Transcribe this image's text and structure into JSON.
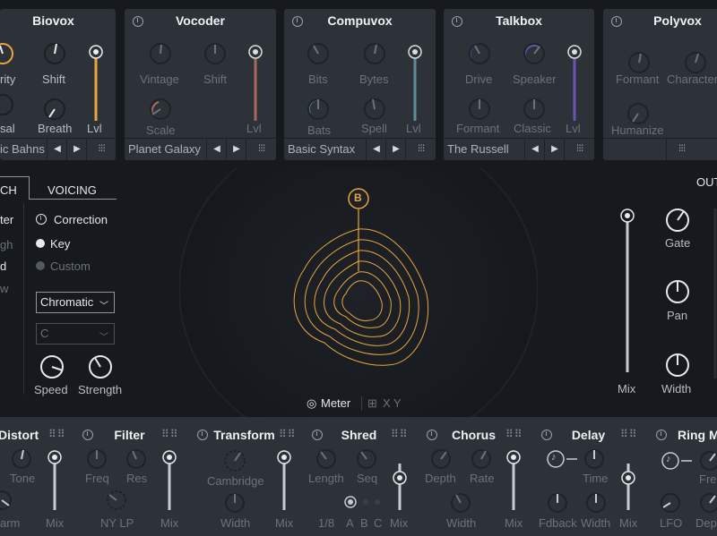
{
  "modules": [
    {
      "id": "biovox",
      "title": "Biovox",
      "knobs": [
        "rity",
        "Shift",
        "sal",
        "Breath"
      ],
      "lvl": "Lvl",
      "preset": "ic Bahns"
    },
    {
      "id": "vocoder",
      "title": "Vocoder",
      "knobs": [
        "Vintage",
        "Shift",
        "Scale"
      ],
      "lvl": "Lvl",
      "preset": "Planet Galaxy"
    },
    {
      "id": "compuvox",
      "title": "Compuvox",
      "knobs": [
        "Bits",
        "Bytes",
        "Bats",
        "Spell"
      ],
      "lvl": "Lvl",
      "preset": "Basic Syntax"
    },
    {
      "id": "talkbox",
      "title": "Talkbox",
      "knobs": [
        "Drive",
        "Speaker",
        "Formant",
        "Classic"
      ],
      "lvl": "Lvl",
      "preset": "The Russell"
    },
    {
      "id": "polyvox",
      "title": "Polyvox",
      "knobs": [
        "Formant",
        "Character",
        "Humanize"
      ],
      "lvl": "",
      "preset": ""
    }
  ],
  "pitch": {
    "tabs": [
      "CH",
      "VOICING"
    ],
    "left_labels": [
      "ter",
      "gh",
      "d",
      "w"
    ],
    "correction": "Correction",
    "key": "Key",
    "custom": "Custom",
    "scale_select": "Chromatic",
    "key_select": "C",
    "knobs": [
      "Speed",
      "Strength"
    ]
  },
  "visual": {
    "marker": "B",
    "meter": "Meter",
    "xy": "X Y"
  },
  "output": {
    "title": "OUT",
    "mix": "Mix",
    "knobs": [
      "Gate",
      "Pan",
      "Width"
    ]
  },
  "effects": [
    {
      "id": "distort",
      "title": "Distort",
      "knobs": [
        "Tone",
        "arm"
      ],
      "mix": "Mix"
    },
    {
      "id": "filter",
      "title": "Filter",
      "knobs": [
        "Freq",
        "Res",
        "NY LP"
      ],
      "mix": "Mix"
    },
    {
      "id": "transform",
      "title": "Transform",
      "knobs": [
        "Cambridge",
        "Width"
      ],
      "mix": "Mix"
    },
    {
      "id": "shred",
      "title": "Shred",
      "knobs": [
        "Length",
        "Seq"
      ],
      "rate": "1/8",
      "abc": [
        "A",
        "B",
        "C"
      ],
      "mix": "Mix"
    },
    {
      "id": "chorus",
      "title": "Chorus",
      "knobs": [
        "Depth",
        "Rate",
        "Width"
      ],
      "mix": "Mix"
    },
    {
      "id": "delay",
      "title": "Delay",
      "knobs": [
        "Time",
        "Fdback",
        "Width"
      ],
      "mix": "Mix"
    },
    {
      "id": "ringmod",
      "title": "Ring M",
      "knobs": [
        "Fre",
        "LFO",
        "Dep"
      ]
    }
  ],
  "colors": {
    "accent": "#e9a63a",
    "biovox_lvl": "#e9a63a",
    "vocoder_lvl": "#a9685a",
    "compuvox_lvl": "#5f8c99",
    "talkbox_lvl": "#6a53b5"
  }
}
